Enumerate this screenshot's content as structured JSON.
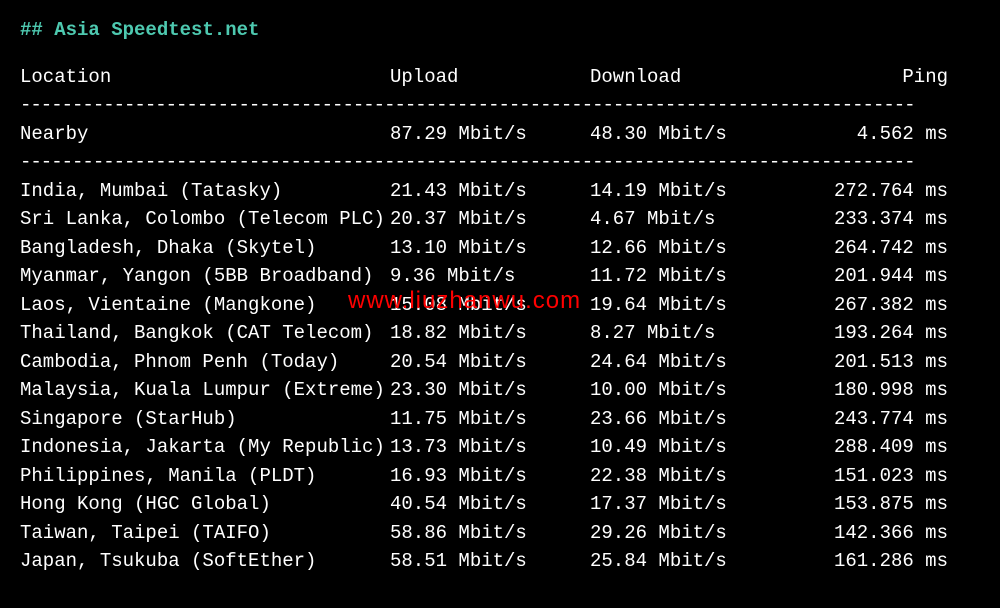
{
  "title": "## Asia Speedtest.net",
  "headers": {
    "location": "Location",
    "upload": "Upload",
    "download": "Download",
    "ping": "Ping"
  },
  "divider": "--------------------------------------------------------------------------------------",
  "nearby": {
    "location": "Nearby",
    "upload": "87.29 Mbit/s",
    "download": "48.30 Mbit/s",
    "ping": "4.562 ms"
  },
  "rows": [
    {
      "location": "India, Mumbai (Tatasky)",
      "upload": "21.43 Mbit/s",
      "download": "14.19 Mbit/s",
      "ping": "272.764 ms"
    },
    {
      "location": "Sri Lanka, Colombo (Telecom PLC)",
      "upload": "20.37 Mbit/s",
      "download": "4.67 Mbit/s",
      "ping": "233.374 ms"
    },
    {
      "location": "Bangladesh, Dhaka (Skytel)",
      "upload": "13.10 Mbit/s",
      "download": "12.66 Mbit/s",
      "ping": "264.742 ms"
    },
    {
      "location": "Myanmar, Yangon (5BB Broadband)",
      "upload": "9.36 Mbit/s",
      "download": "11.72 Mbit/s",
      "ping": "201.944 ms"
    },
    {
      "location": "Laos, Vientaine (Mangkone)",
      "upload": "15.08 Mbit/s",
      "download": "19.64 Mbit/s",
      "ping": "267.382 ms"
    },
    {
      "location": "Thailand, Bangkok (CAT Telecom)",
      "upload": "18.82 Mbit/s",
      "download": "8.27 Mbit/s",
      "ping": "193.264 ms"
    },
    {
      "location": "Cambodia, Phnom Penh (Today)",
      "upload": "20.54 Mbit/s",
      "download": "24.64 Mbit/s",
      "ping": "201.513 ms"
    },
    {
      "location": "Malaysia, Kuala Lumpur (Extreme)",
      "upload": "23.30 Mbit/s",
      "download": "10.00 Mbit/s",
      "ping": "180.998 ms"
    },
    {
      "location": "Singapore (StarHub)",
      "upload": "11.75 Mbit/s",
      "download": "23.66 Mbit/s",
      "ping": "243.774 ms"
    },
    {
      "location": "Indonesia, Jakarta (My Republic)",
      "upload": "13.73 Mbit/s",
      "download": "10.49 Mbit/s",
      "ping": "288.409 ms"
    },
    {
      "location": "Philippines, Manila (PLDT)",
      "upload": "16.93 Mbit/s",
      "download": "22.38 Mbit/s",
      "ping": "151.023 ms"
    },
    {
      "location": "Hong Kong (HGC Global)",
      "upload": "40.54 Mbit/s",
      "download": "17.37 Mbit/s",
      "ping": "153.875 ms"
    },
    {
      "location": "Taiwan, Taipei (TAIFO)",
      "upload": "58.86 Mbit/s",
      "download": "29.26 Mbit/s",
      "ping": "142.366 ms"
    },
    {
      "location": "Japan, Tsukuba (SoftEther)",
      "upload": "58.51 Mbit/s",
      "download": "25.84 Mbit/s",
      "ping": "161.286 ms"
    }
  ],
  "watermark": "www.liuzhanwu.com"
}
